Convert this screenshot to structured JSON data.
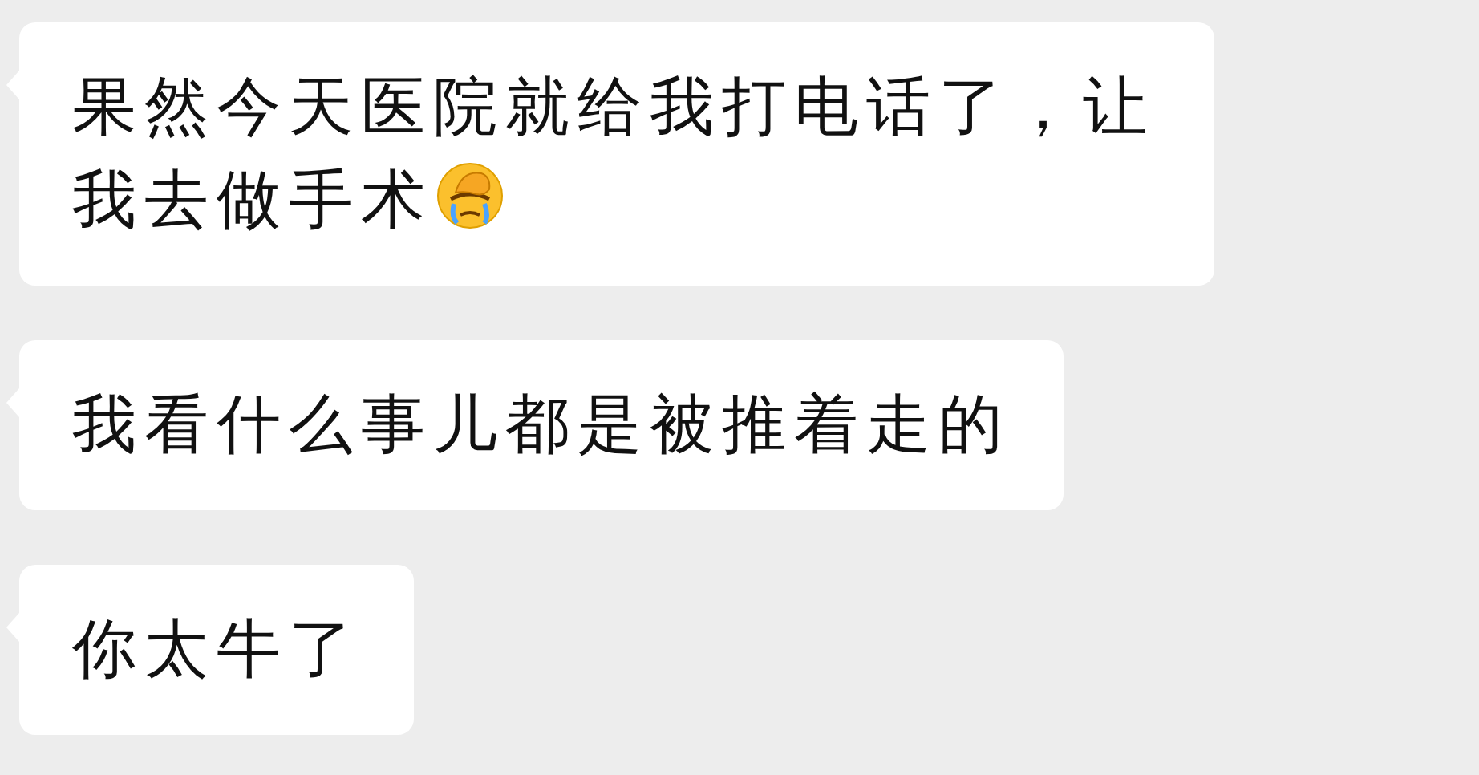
{
  "messages": [
    {
      "text": "果然今天医院就给我打电话了，让我去做手术",
      "has_emoji": true
    },
    {
      "text": "我看什么事儿都是被推着走的",
      "has_emoji": false
    },
    {
      "text": "你太牛了",
      "has_emoji": false
    }
  ]
}
